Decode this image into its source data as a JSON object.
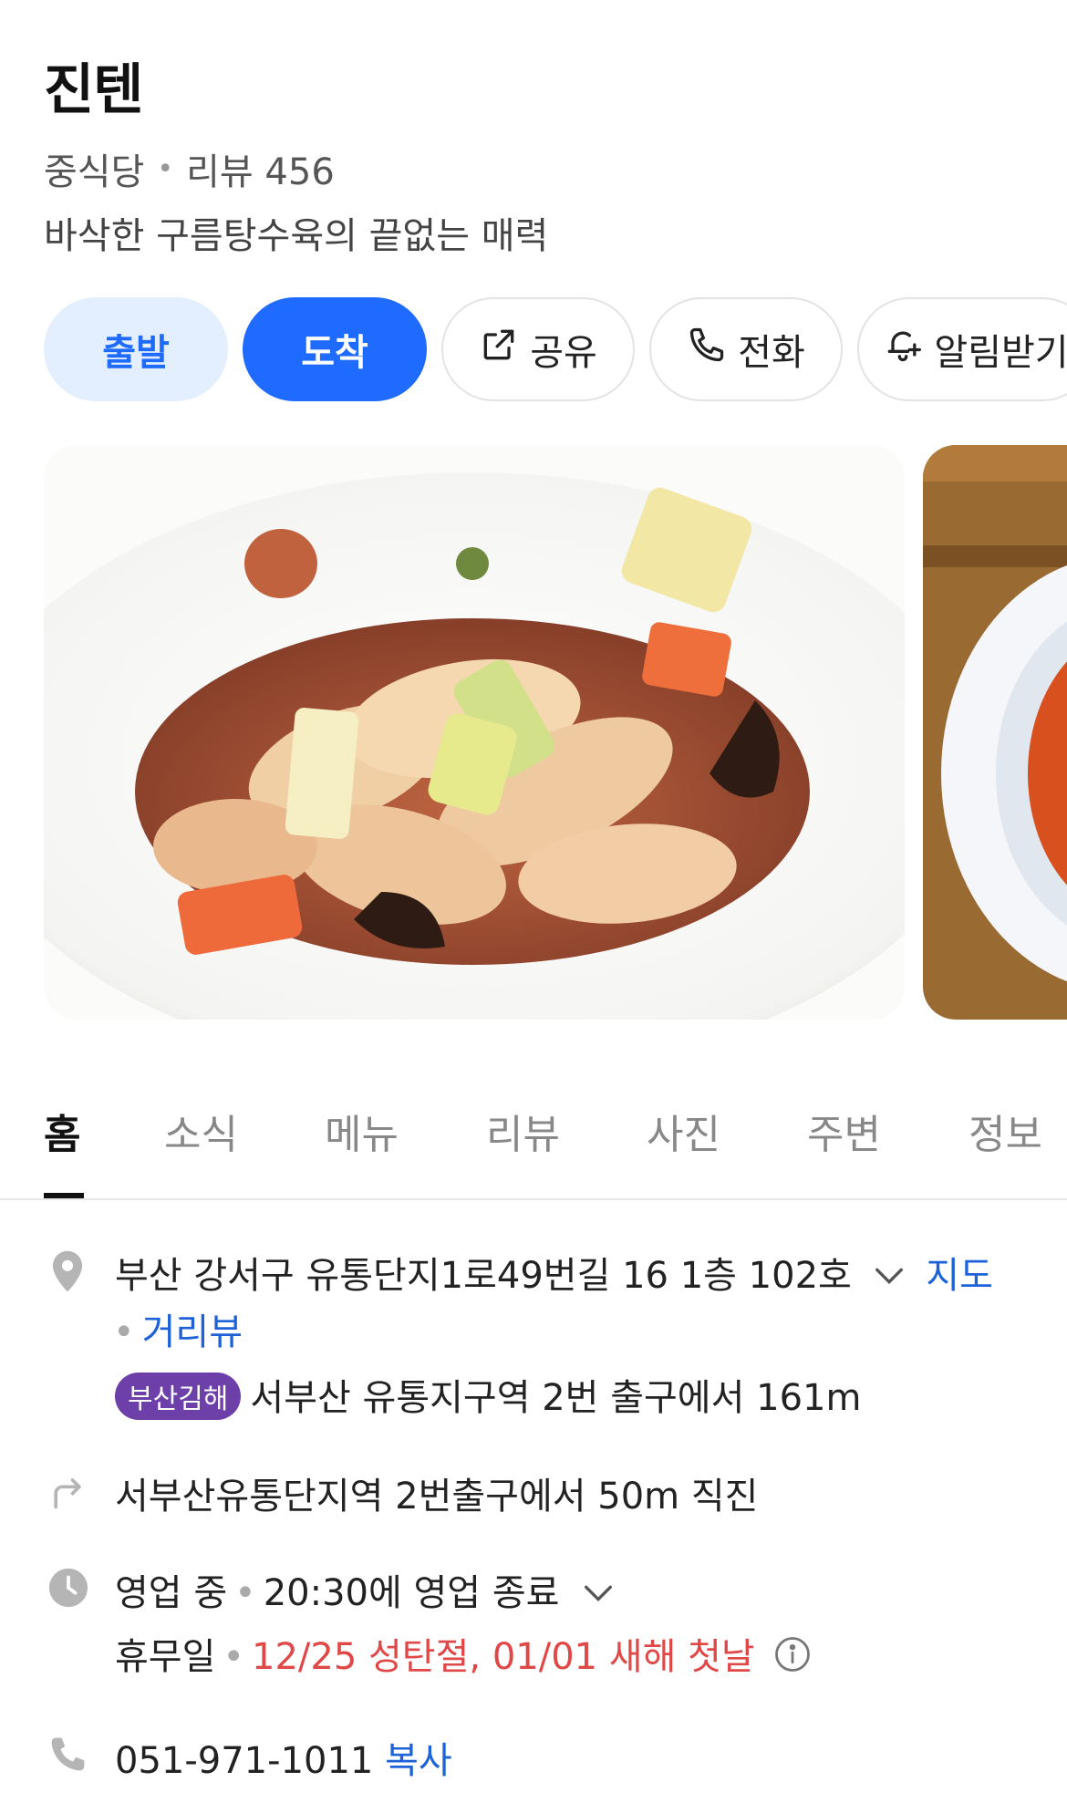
{
  "place": {
    "name": "진텐",
    "category": "중식당",
    "review_label": "리뷰 456",
    "description": "바삭한 구름탕수육의 끝없는 매력"
  },
  "actions": {
    "depart": "출발",
    "arrive": "도착",
    "share": "공유",
    "call": "전화",
    "alarm": "알림받기"
  },
  "tabs": [
    {
      "label": "홈"
    },
    {
      "label": "소식"
    },
    {
      "label": "메뉴"
    },
    {
      "label": "리뷰"
    },
    {
      "label": "사진"
    },
    {
      "label": "주변"
    },
    {
      "label": "정보"
    }
  ],
  "info": {
    "address": "부산 강서구 유통단지1로49번길 16 1층 102호",
    "map_link": "지도",
    "street_view_link": "거리뷰",
    "subway_badge": "부산김해",
    "subway_text": "서부산 유통지구역 2번 출구에서 161m",
    "directions": "서부산유통단지역 2번출구에서 50m 직진",
    "hours_status": "영업 중",
    "hours_detail": "20:30에 영업 종료",
    "closed_label": "휴무일",
    "closed_days": "12/25 성탄절, 01/01 새해 첫날",
    "phone": "051-971-1011",
    "copy_link": "복사"
  },
  "colors": {
    "accent": "#1f6bff",
    "accent_light": "#e3efff",
    "link": "#1d62d8",
    "holiday_red": "#e04848",
    "subway_badge": "#6d3fa8"
  }
}
